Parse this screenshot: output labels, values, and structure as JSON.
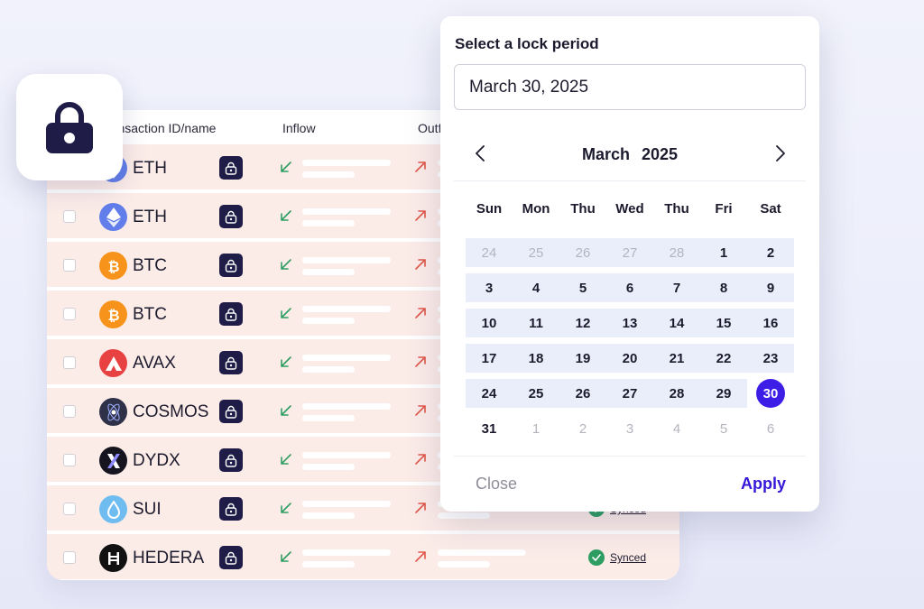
{
  "table": {
    "headers": {
      "name": "Transaction ID/name",
      "inflow": "Inflow",
      "outflow": "Outflow"
    },
    "rows": [
      {
        "coin": "ETH",
        "icon": "ethereum-icon",
        "color": "#627eea",
        "status": ""
      },
      {
        "coin": "ETH",
        "icon": "ethereum-icon",
        "color": "#627eea",
        "status": ""
      },
      {
        "coin": "BTC",
        "icon": "bitcoin-icon",
        "color": "#f7931a",
        "status": ""
      },
      {
        "coin": "BTC",
        "icon": "bitcoin-icon",
        "color": "#f7931a",
        "status": ""
      },
      {
        "coin": "AVAX",
        "icon": "avalanche-icon",
        "color": "#e84142",
        "status": ""
      },
      {
        "coin": "COSMOS",
        "icon": "cosmos-icon",
        "color": "#2e3148",
        "status": ""
      },
      {
        "coin": "DYDX",
        "icon": "dydx-icon",
        "color": "#15141f",
        "status": ""
      },
      {
        "coin": "SUI",
        "icon": "sui-icon",
        "color": "#6fbcf0",
        "status": "Synced"
      },
      {
        "coin": "HEDERA",
        "icon": "hedera-icon",
        "color": "#111111",
        "status": "Synced"
      }
    ],
    "row_color": "#fcece8",
    "inflow_color": "#2f9e63",
    "outflow_color": "#e0574a",
    "status_color": "#2f9e63"
  },
  "picker": {
    "title": "Select a lock period",
    "input_value": "March 30, 2025",
    "month": "March",
    "year": "2025",
    "weekdays": [
      "Sun",
      "Mon",
      "Thu",
      "Wed",
      "Thu",
      "Fri",
      "Sat"
    ],
    "weeks": [
      [
        "24",
        "25",
        "26",
        "27",
        "28",
        "1",
        "2"
      ],
      [
        "3",
        "4",
        "5",
        "6",
        "7",
        "8",
        "9"
      ],
      [
        "10",
        "11",
        "12",
        "13",
        "14",
        "15",
        "16"
      ],
      [
        "17",
        "18",
        "19",
        "20",
        "21",
        "22",
        "23"
      ],
      [
        "24",
        "25",
        "26",
        "27",
        "28",
        "29",
        "30"
      ],
      [
        "31",
        "1",
        "2",
        "3",
        "4",
        "5",
        "6"
      ]
    ],
    "selected_day": "30",
    "close_label": "Close",
    "apply_label": "Apply",
    "accent_color": "#3d1ee6"
  }
}
